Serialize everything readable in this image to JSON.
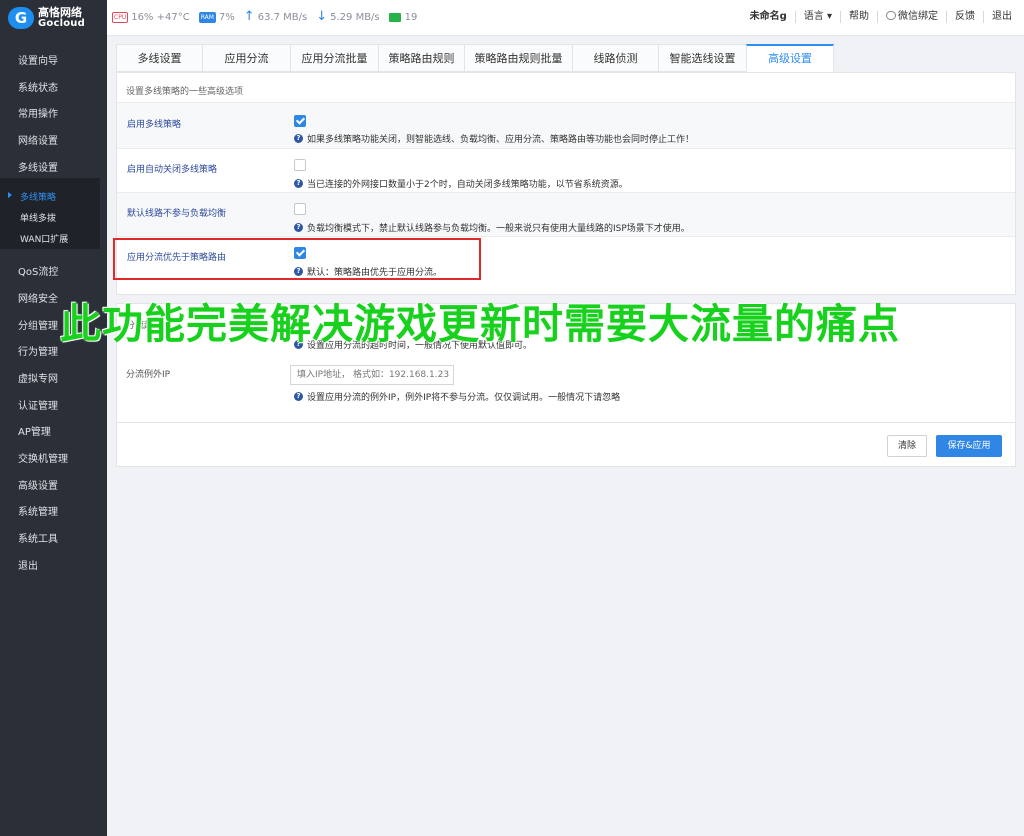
{
  "brand": {
    "logo_mark": "G",
    "name_cn": "高恪网络",
    "name_en": "Gocloud"
  },
  "topbar": {
    "cpu_chip": "CPU",
    "cpu_stat": "16% +47°C",
    "ram_chip": "RAM",
    "ram_stat": "7%",
    "up_icon": "upload-arrow-icon",
    "up_stat": "63.7 MB/s",
    "down_icon": "download-arrow-icon",
    "down_stat": "5.29 MB/s",
    "online_count": "19",
    "device_name": "未命名g",
    "language": "语言 ▾",
    "help": "帮助",
    "wechat": "微信绑定",
    "feedback": "反馈",
    "logout": "退出"
  },
  "sidebar": {
    "items": [
      "设置向导",
      "系统状态",
      "常用操作",
      "网络设置",
      "多线设置"
    ],
    "sub_items": [
      "多线策略",
      "单线多拨",
      "WAN口扩展"
    ],
    "items_after": [
      "QoS流控",
      "网络安全",
      "分组管理",
      "行为管理",
      "虚拟专网",
      "认证管理",
      "AP管理",
      "交换机管理",
      "高级设置",
      "系统管理",
      "系统工具",
      "退出"
    ]
  },
  "tabs": [
    "多线设置",
    "应用分流",
    "应用分流批量",
    "策略路由规则",
    "策略路由规则批量",
    "线路侦测",
    "智能选线设置",
    "高级设置"
  ],
  "active_tab": "高级设置",
  "section": {
    "description": "设置多线策略的一些高级选项",
    "options": [
      {
        "label": "启用多线策略",
        "checked": true,
        "hint": "如果多线策略功能关闭，则智能选线、负载均衡、应用分流、策略路由等功能也会同时停止工作！"
      },
      {
        "label": "启用自动关闭多线策略",
        "checked": false,
        "hint": "当已连接的外网接口数量小于2个时，自动关闭多线策略功能，以节省系统资源。"
      },
      {
        "label": "默认线路不参与负载均衡",
        "checked": false,
        "hint": "负载均衡模式下，禁止默认线路参与负载均衡。一般来说只有使用大量线路的ISP场景下才使用。"
      },
      {
        "label": "应用分流优先于策略路由",
        "checked": true,
        "hint": "默认：策略路由优先于应用分流。"
      }
    ]
  },
  "section2": {
    "timeout_label": "分流超",
    "timeout_hint": "设置应用分流的超时时间，一般情况下使用默认值即可。",
    "exception_label": "分流例外IP",
    "exception_placeholder": "填入IP地址， 格式如：192.168.1.23",
    "exception_hint": "设置应用分流的例外IP，例外IP将不参与分流。仅仅调试用。一般情况下请忽略"
  },
  "buttons": {
    "clear": "清除",
    "save": "保存&应用"
  },
  "overlay_caption": "此功能完美解决游戏更新时需要大流量的痛点",
  "colors": {
    "accent": "#2f8ff0",
    "highlight_border": "#e02a2a",
    "overlay_text": "#18d11d",
    "sidebar_bg": "#2b3038"
  }
}
